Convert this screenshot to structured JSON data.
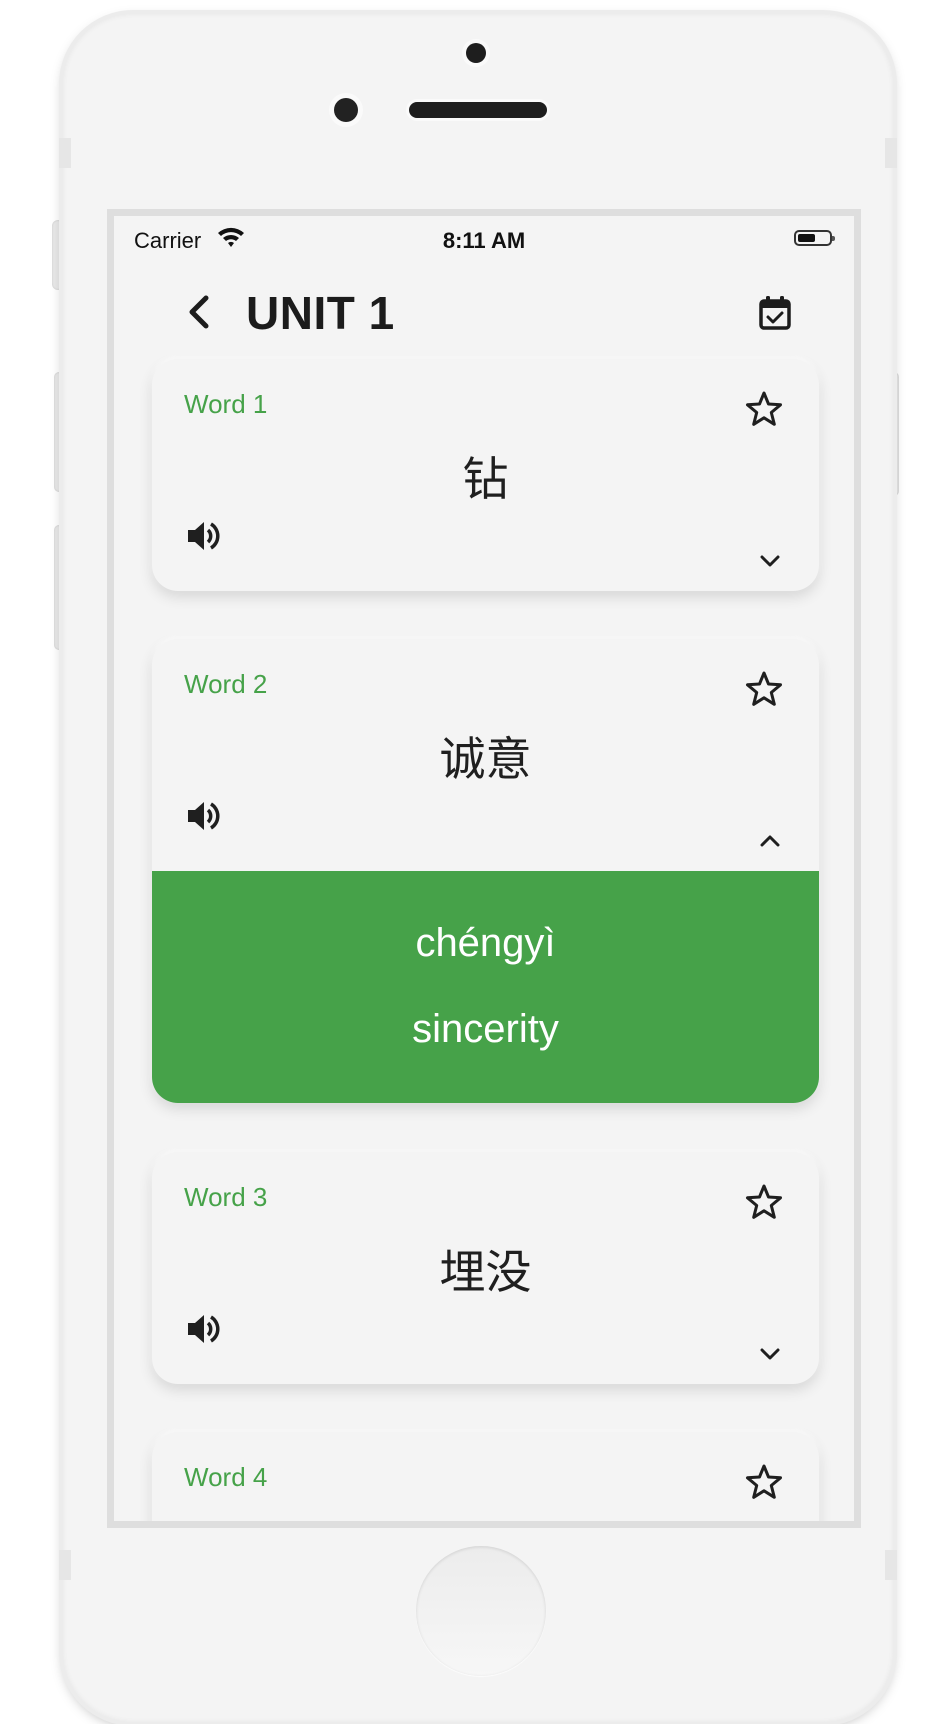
{
  "status_bar": {
    "carrier": "Carrier",
    "time": "8:11 AM",
    "wifi_icon": "wifi-icon",
    "battery_icon": "battery-icon"
  },
  "header": {
    "title": "UNIT 1",
    "back_icon": "chevron-left-icon",
    "calendar_icon": "calendar-check-icon"
  },
  "accent_color": "#46a249",
  "words": [
    {
      "label": "Word 1",
      "hanzi": "钻",
      "expanded": false
    },
    {
      "label": "Word 2",
      "hanzi": "诚意",
      "expanded": true,
      "pinyin": "chéngyì",
      "meaning": "sincerity"
    },
    {
      "label": "Word 3",
      "hanzi": "埋没",
      "expanded": false
    },
    {
      "label": "Word 4",
      "hanzi": "",
      "expanded": false
    }
  ]
}
